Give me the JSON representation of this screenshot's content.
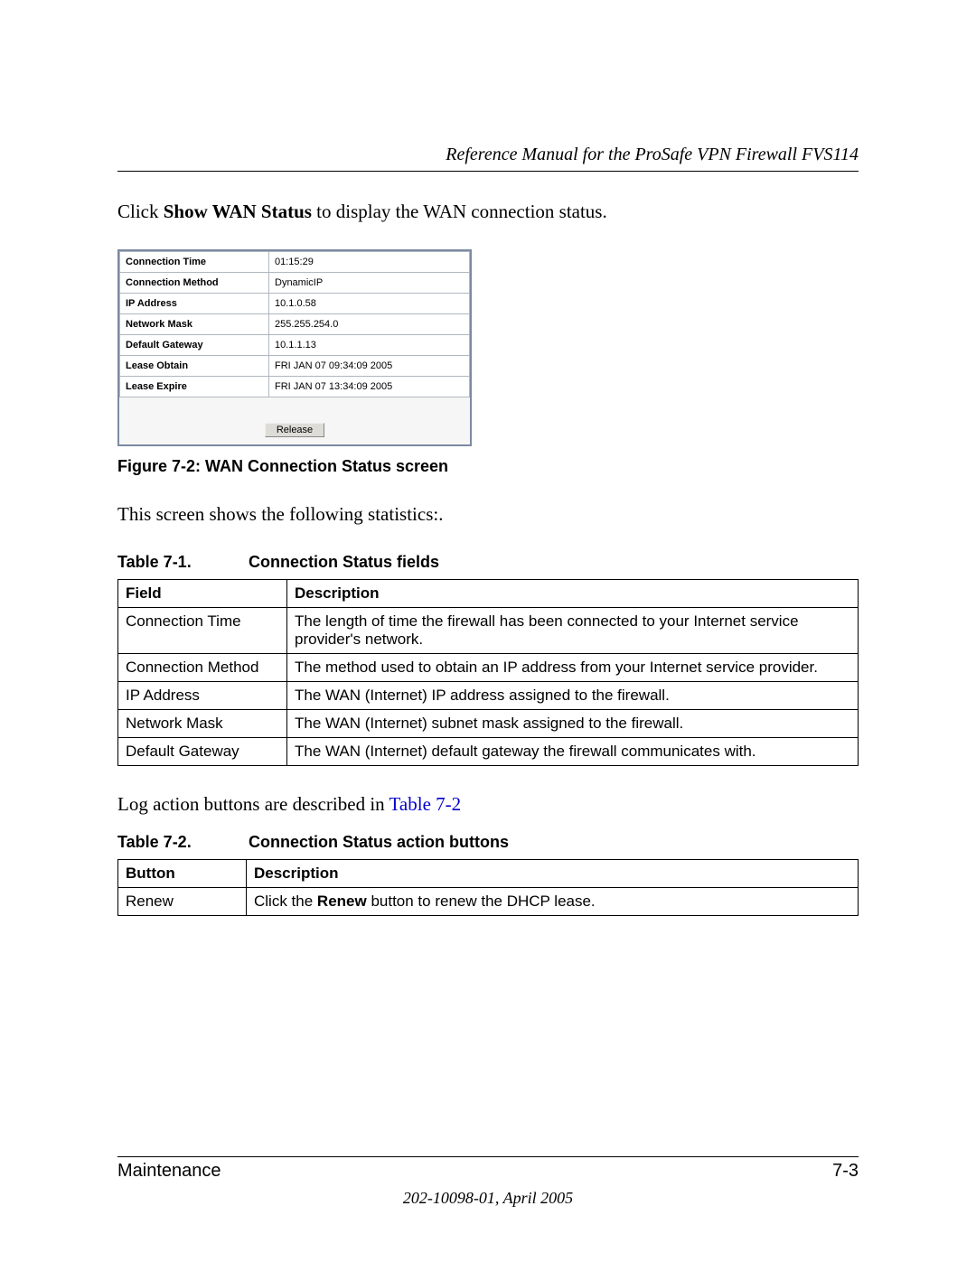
{
  "header": {
    "running_title": "Reference Manual for the ProSafe VPN Firewall FVS114"
  },
  "intro": {
    "pre": "Click ",
    "bold": "Show WAN Status",
    "post": " to display the WAN connection status."
  },
  "screenshot": {
    "rows": [
      {
        "label": "Connection Time",
        "value": "01:15:29"
      },
      {
        "label": "Connection Method",
        "value": "DynamicIP"
      },
      {
        "label": "IP Address",
        "value": "10.1.0.58"
      },
      {
        "label": "Network Mask",
        "value": "255.255.254.0"
      },
      {
        "label": "Default Gateway",
        "value": "10.1.1.13"
      },
      {
        "label": "Lease Obtain",
        "value": "FRI JAN 07 09:34:09 2005"
      },
      {
        "label": "Lease Expire",
        "value": "FRI JAN 07 13:34:09 2005"
      }
    ],
    "button": "Release"
  },
  "fig_caption": "Figure 7-2:  WAN Connection Status screen",
  "para_after_fig": "This screen shows the following statistics:.",
  "table71": {
    "caption_label": "Table 7-1.",
    "caption_title": "Connection Status fields",
    "col1": "Field",
    "col2": "Description",
    "rows": [
      {
        "f": "Connection Time",
        "d": "The length of time the firewall has been connected to your Internet service provider's network."
      },
      {
        "f": "Connection Method",
        "d": "The method used to obtain an IP address from your Internet service provider."
      },
      {
        "f": "IP Address",
        "d": "The WAN (Internet) IP address assigned to the firewall."
      },
      {
        "f": "Network Mask",
        "d": "The WAN (Internet) subnet mask assigned to the firewall."
      },
      {
        "f": "Default Gateway",
        "d": "The WAN (Internet) default gateway the firewall communicates with."
      }
    ]
  },
  "log_para": {
    "pre": "Log action buttons are described in ",
    "link": "Table 7-2"
  },
  "table72": {
    "caption_label": "Table 7-2.",
    "caption_title": "Connection Status action buttons",
    "col1": "Button",
    "col2": "Description",
    "rows": [
      {
        "b": "Renew",
        "d_pre": "Click the ",
        "d_bold": "Renew",
        "d_post": " button to renew the DHCP lease."
      }
    ]
  },
  "footer": {
    "section": "Maintenance",
    "pagenum": "7-3",
    "docnum": "202-10098-01, April 2005"
  }
}
